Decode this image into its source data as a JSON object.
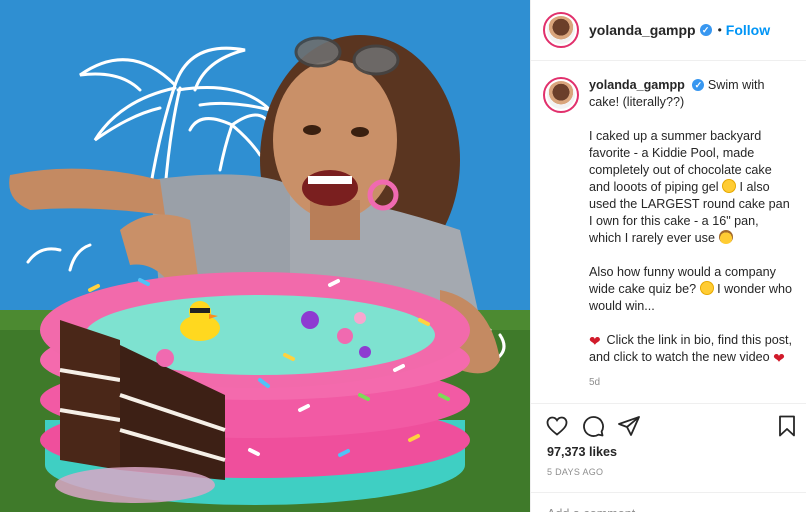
{
  "post": {
    "image_alt": "Woman smiling next to a kiddie pool cake",
    "author": {
      "username": "yolanda_gampp",
      "verified_mark": "✓",
      "separator": "•",
      "follow_label": "Follow"
    },
    "caption": {
      "username": "yolanda_gampp",
      "line1": "Swim with cake! (literally??)",
      "para2": "I caked up a summer backyard favorite - a Kiddie Pool, made completely out of chocolate cake and looots of piping gel",
      "para2b": "I also used the LARGEST round cake pan I own for this cake - a 16\" pan, which I rarely ever use",
      "para3": "Also how funny would a company wide cake quiz be?",
      "para3b": "I wonder who would win...",
      "para4": "Click the link in bio, find this post, and click to watch the new video",
      "age": "5d"
    },
    "likes": "97,373 likes",
    "timestamp": "5 DAYS AGO",
    "comment_placeholder": "Add a comment..."
  },
  "icons": [
    "heart-icon",
    "comment-icon",
    "share-icon",
    "bookmark-icon",
    "verified-icon",
    "grin-emoji-icon",
    "mind-blown-emoji-icon",
    "heart-emoji-icon"
  ],
  "colors": {
    "follow_blue": "#0095f6",
    "verified_blue": "#3897f0",
    "cake_pink": "#ef4f9c",
    "pool_teal": "#3fcfc3",
    "background_blue": "#2f8fd2",
    "grass": "#3f7a2a"
  }
}
